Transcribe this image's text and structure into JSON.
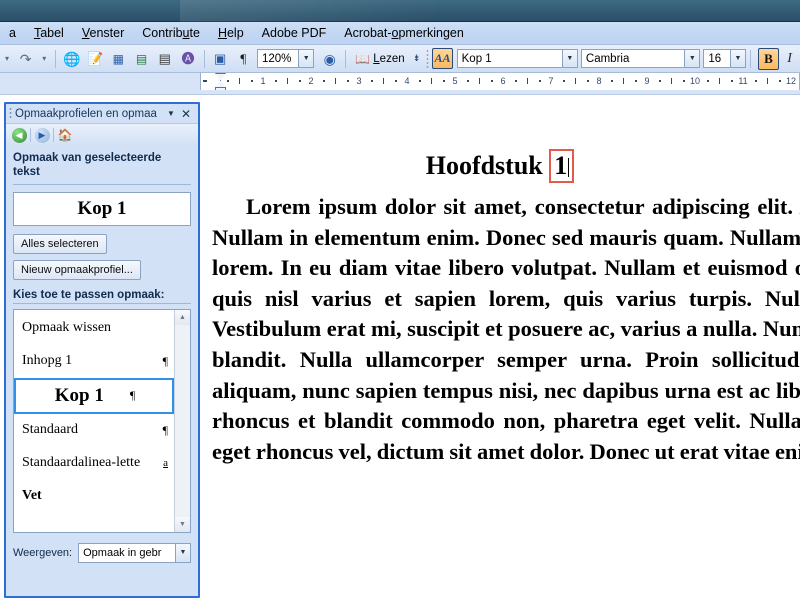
{
  "window": {
    "titlebar_color": "#36607a"
  },
  "menubar": {
    "items": [
      {
        "label": "a",
        "accel": "",
        "name": "menu-truncated-left"
      },
      {
        "label": "Tabel",
        "accel": "T",
        "name": "menu-tabel"
      },
      {
        "label": "Venster",
        "accel": "V",
        "name": "menu-venster"
      },
      {
        "label": "Contribute",
        "accel": "u",
        "name": "menu-contribute"
      },
      {
        "label": "Help",
        "accel": "H",
        "name": "menu-help"
      },
      {
        "label": "Adobe PDF",
        "accel": "",
        "name": "menu-adobe-pdf"
      },
      {
        "label": "Acrobat-opmerkingen",
        "accel": "o",
        "name": "menu-acrobat-opmerkingen"
      }
    ]
  },
  "toolbar": {
    "undo_arrow": "↶",
    "redo_arrow": "↷",
    "dropdown_arrow": "▾",
    "buttons": [
      {
        "name": "insert-hyperlink-icon",
        "glyph": "🔗"
      },
      {
        "name": "insert-drawing-icon",
        "glyph": "✎"
      },
      {
        "name": "insert-table-icon",
        "glyph": "▦"
      },
      {
        "name": "insert-excel-sheet-icon",
        "glyph": "▤"
      },
      {
        "name": "columns-icon",
        "glyph": "▥"
      },
      {
        "name": "drawing-toolbar-icon",
        "glyph": "A"
      },
      {
        "name": "document-map-icon",
        "glyph": "▣"
      },
      {
        "name": "show-formatting-marks-icon",
        "glyph": "¶"
      }
    ],
    "zoom_value": "120%",
    "help_icon": "?",
    "read_label": "Lezen",
    "read_icon": "book-icon"
  },
  "formatting_toolbar": {
    "styles_pane_icon": "AA",
    "style_value": "Kop 1",
    "font_value": "Cambria",
    "size_value": "16",
    "bold_label": "B",
    "italic_label": "I",
    "bold_active_color": "#fbb95e"
  },
  "ruler": {
    "numbers": [
      "1",
      "2",
      "3",
      "4",
      "5",
      "6",
      "7",
      "8",
      "9",
      "10",
      "11",
      "12"
    ],
    "start_label": "2"
  },
  "task_pane": {
    "title": "Opmaakprofielen en opmaa",
    "caret": "▼",
    "close": "✕",
    "nav": {
      "back": "◀",
      "forward": "▶",
      "home": "⌂"
    },
    "section_label": "Opmaak van geselecteerde tekst",
    "preview_text": "Kop 1",
    "select_all_button": "Alles selecteren",
    "new_style_button": "Nieuw opmaakprofiel...",
    "apply_label": "Kies toe te passen opmaak:",
    "styles": [
      {
        "label": "Opmaak wissen",
        "mark": "",
        "selected": false,
        "bold": false
      },
      {
        "label": "Inhopg 1",
        "mark": "¶",
        "selected": false,
        "bold": false
      },
      {
        "label": "Kop 1",
        "mark": "¶",
        "selected": true,
        "bold": true
      },
      {
        "label": "Standaard",
        "mark": "¶",
        "selected": false,
        "bold": false
      },
      {
        "label": "Standaardalinea-lette",
        "mark": "a",
        "selected": false,
        "bold": false
      },
      {
        "label": "Vet",
        "mark": "",
        "selected": false,
        "bold": true
      }
    ],
    "show_label": "Weergeven:",
    "show_value": "Opmaak in gebr",
    "scroll_up": "▲",
    "scroll_down": "▼",
    "border_color": "#2e6fd4",
    "selection_color": "#2e92e8"
  },
  "document": {
    "heading_prefix": "Hoofdstuk ",
    "heading_highlight": "1",
    "highlight_color": "#e05b4a",
    "body": "Lorem ipsum dolor sit amet, consectetur adipiscing elit. Aenean dignissim augue. Nullam in elementum enim. Donec sed mauris quam. Nullam ac lorem mi, a dignissim lorem. In eu diam vitae libero volutpat. Nullam et euismod odio. Praesent eget purus quis nisl varius et sapien lorem, quis varius turpis. Nulla vitae urna sed nibh. Vestibulum erat mi, suscipit et posuere ac, varius a nulla. Nunc ligula et eros accumsan blandit. Nulla ullamcorper semper urna. Proin sollicitudin, libero ut malesuada aliquam, nunc sapien tempus nisi, nec dapibus urna est ac libero. Phasellus nibh enim, rhoncus et blandit commodo non, pharetra eget velit. Nullam sit amet nulla sodales eget rhoncus vel, dictum sit amet dolor. Donec ut erat vitae enim aliquam ultricies."
  }
}
